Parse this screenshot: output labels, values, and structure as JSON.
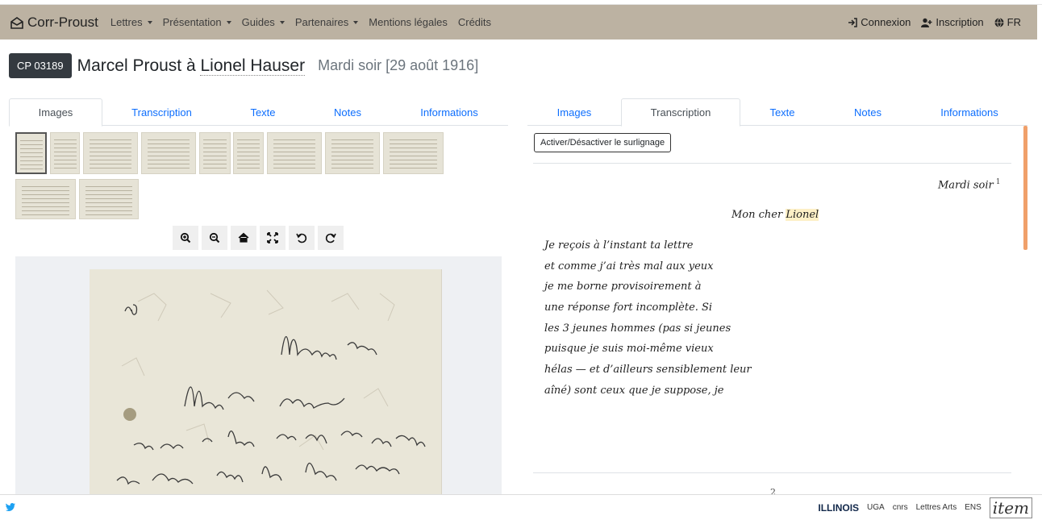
{
  "navbar": {
    "brand": "Corr-Proust",
    "menu": [
      {
        "label": "Lettres",
        "dropdown": true
      },
      {
        "label": "Présentation",
        "dropdown": true
      },
      {
        "label": "Guides",
        "dropdown": true
      },
      {
        "label": "Partenaires",
        "dropdown": true
      },
      {
        "label": "Mentions légales",
        "dropdown": false
      },
      {
        "label": "Crédits",
        "dropdown": false
      }
    ],
    "connexion": "Connexion",
    "inscription": "Inscription",
    "language": "FR"
  },
  "letter": {
    "id": "CP 03189",
    "title_prefix": "Marcel Proust à ",
    "recipient": "Lionel Hauser",
    "date": "Mardi soir [29 août 1916]"
  },
  "left_tabs": [
    "Images",
    "Transcription",
    "Texte",
    "Notes",
    "Informations"
  ],
  "left_active": "Images",
  "right_tabs": [
    "Images",
    "Transcription",
    "Texte",
    "Notes",
    "Informations"
  ],
  "right_active": "Transcription",
  "thumbnails_count": 11,
  "viewer_tools": [
    "zoom-in-icon",
    "zoom-out-icon",
    "home-icon",
    "fullscreen-icon",
    "rotate-left-icon",
    "rotate-right-icon"
  ],
  "transcription": {
    "toggle_button": "Activer/Désactiver le surlignage",
    "heading_date": "Mardi soir",
    "heading_note": "1",
    "salutation_prefix": "Mon cher ",
    "salutation_name": "Lionel",
    "lines": [
      "Je reçois à l’instant ta lettre",
      "et comme j’ai très mal aux yeux",
      "je me borne provisoirement à",
      "une réponse fort incomplète. Si",
      "les 3 jeunes hommes (pas si jeunes",
      "puisque je suis moi-même vieux",
      "hélas — et d’ailleurs sensiblement leur",
      "aîné) sont ceux que je suppose, je"
    ],
    "next_page_number": "2"
  },
  "footer": {
    "logos": [
      "ILLINOIS",
      "UGA",
      "cnrs",
      "Lettres Arts",
      "ENS",
      "item"
    ]
  },
  "colors": {
    "navbar": "#bcb2a2",
    "link": "#0d6efd",
    "badge": "#343a40",
    "highlight": "#fdf0c6",
    "scroll": "#f0a06a"
  }
}
